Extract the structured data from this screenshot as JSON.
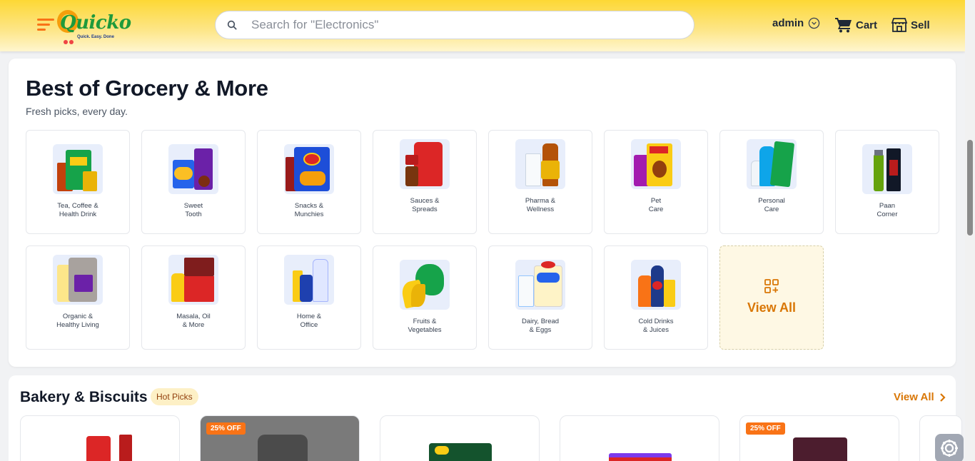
{
  "header": {
    "logo_text": "Quicko",
    "logo_tagline": "Quick. Easy. Done",
    "search_placeholder": "Search for \"Electronics\"",
    "user_label": "admin",
    "cart_label": "Cart",
    "sell_label": "Sell"
  },
  "grocery": {
    "title": "Best of Grocery & More",
    "subtitle": "Fresh picks, every day.",
    "view_all_label": "View All",
    "categories": [
      {
        "label": "Tea, Coffee &\nHealth Drink"
      },
      {
        "label": "Sweet\nTooth"
      },
      {
        "label": "Snacks &\nMunchies"
      },
      {
        "label": "Sauces &\nSpreads"
      },
      {
        "label": "Pharma &\nWellness"
      },
      {
        "label": "Pet\nCare"
      },
      {
        "label": "Personal\nCare"
      },
      {
        "label": "Paan\nCorner"
      },
      {
        "label": "Organic &\nHealthy Living"
      },
      {
        "label": "Masala, Oil\n& More"
      },
      {
        "label": "Home &\nOffice"
      },
      {
        "label": "Fruits &\nVegetables"
      },
      {
        "label": "Dairy, Bread\n& Eggs"
      },
      {
        "label": "Cold Drinks\n& Juices"
      }
    ]
  },
  "bakery": {
    "title": "Bakery & Biscuits",
    "badge": "Hot Picks",
    "view_all_label": "View All",
    "products": [
      {
        "discount": ""
      },
      {
        "discount": "25% OFF"
      },
      {
        "discount": ""
      },
      {
        "discount": ""
      },
      {
        "discount": "25% OFF"
      }
    ]
  },
  "colors": {
    "accent": "#d97706",
    "brand_green": "#1e9a3b",
    "header_yellow": "#fdd835",
    "discount_orange": "#f97316"
  }
}
